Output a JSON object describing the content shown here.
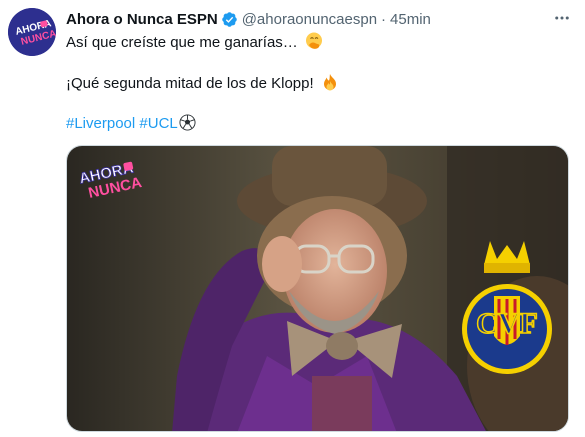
{
  "tweet": {
    "display_name": "Ahora o Nunca ESPN",
    "handle": "@ahoraonuncaespn",
    "separator": "·",
    "time": "45min",
    "line1": "Así que creíste que me ganarías…",
    "line2": "¡Qué segunda mitad de los de Klopp!",
    "hashtags": [
      "#Liverpool",
      "#UCL"
    ],
    "avatar_text": [
      "AHORA",
      "NUNCA"
    ],
    "media_watermark": [
      "AHORA",
      "NUNCA"
    ],
    "crest_letters": "CVF"
  },
  "colors": {
    "link": "#1d9bf0",
    "muted": "#536471",
    "avatar_bg": "#2d2f8f",
    "crest_yellow": "#f5d000",
    "crest_blue": "#1b3a8c"
  },
  "icons": {
    "verified": "verified-badge-icon",
    "more": "more-options-icon",
    "emoji1": "face-with-hand-over-mouth-emoji",
    "emoji2": "fire-emoji",
    "emoji3": "soccer-ball-emoji"
  }
}
